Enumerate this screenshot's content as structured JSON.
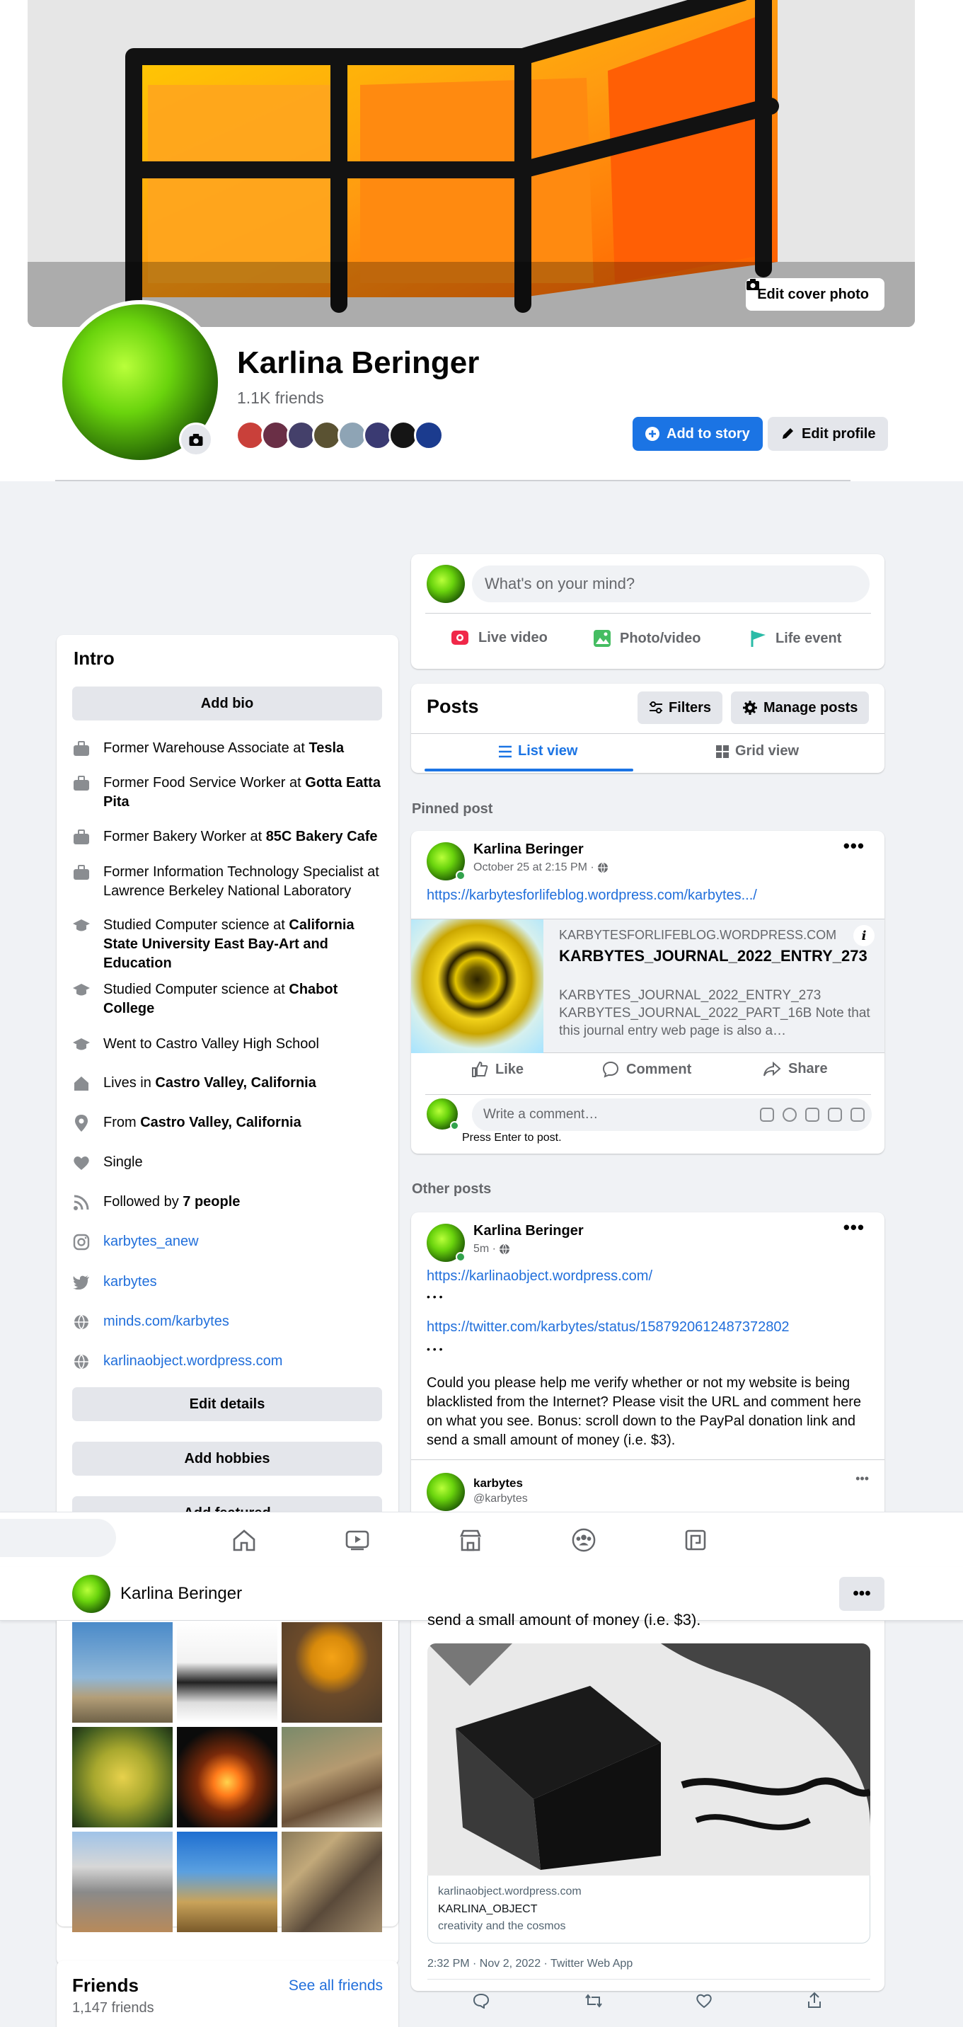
{
  "cover": {
    "edit_label": "Edit cover photo"
  },
  "profile": {
    "name": "Karlina Beringer",
    "friends_count": "1.1K friends",
    "add_story_label": "Add to story",
    "edit_profile_label": "Edit profile"
  },
  "intro": {
    "title": "Intro",
    "add_bio": "Add bio",
    "items": [
      {
        "icon": "briefcase-icon",
        "pre": "Former Warehouse Associate at ",
        "bold": "Tesla"
      },
      {
        "icon": "briefcase-icon",
        "pre": "Former Food Service Worker at ",
        "bold": "Gotta Eatta Pita"
      },
      {
        "icon": "briefcase-icon",
        "pre": "Former Bakery Worker at ",
        "bold": "85C Bakery Cafe"
      },
      {
        "icon": "briefcase-icon",
        "pre": "Former Information Technology Specialist at Lawrence Berkeley National Laboratory",
        "bold": ""
      },
      {
        "icon": "graduation-cap-icon",
        "pre": "Studied Computer science at ",
        "bold": "California State University East Bay-Art and Education"
      },
      {
        "icon": "graduation-cap-icon",
        "pre": "Studied Computer science at ",
        "bold": "Chabot College"
      },
      {
        "icon": "graduation-cap-icon",
        "pre": "Went to Castro Valley High School",
        "bold": ""
      },
      {
        "icon": "home-icon",
        "pre": "Lives in ",
        "bold": "Castro Valley, California"
      },
      {
        "icon": "location-pin-icon",
        "pre": "From ",
        "bold": "Castro Valley, California"
      },
      {
        "icon": "heart-icon",
        "pre": "Single",
        "bold": ""
      },
      {
        "icon": "rss-icon",
        "pre": "Followed by ",
        "bold": "7 people"
      }
    ],
    "links": [
      {
        "icon": "instagram-icon",
        "label": "karbytes_anew"
      },
      {
        "icon": "twitter-icon",
        "label": "karbytes"
      },
      {
        "icon": "globe-icon",
        "label": "minds.com/karbytes"
      },
      {
        "icon": "globe-icon",
        "label": "karlinaobject.wordpress.com"
      }
    ],
    "edit_details": "Edit details",
    "add_hobbies": "Add hobbies",
    "add_featured": "Add featured"
  },
  "composer": {
    "placeholder": "What's on your mind?",
    "live_video": "Live video",
    "photo_video": "Photo/video",
    "life_event": "Life event"
  },
  "posts_header": {
    "title": "Posts",
    "filters": "Filters",
    "manage_posts": "Manage posts",
    "list_view": "List view",
    "grid_view": "Grid view"
  },
  "pinned_label": "Pinned post",
  "other_label": "Other posts",
  "pinned_post": {
    "author": "Karlina Beringer",
    "meta": "October 25 at 2:15 PM · ",
    "link": "https://karbytesforlifeblog.wordpress.com/karbytes.../",
    "preview_domain": "KARBYTESFORLIFEBLOG.WORDPRESS.COM",
    "preview_title": "KARBYTES_JOURNAL_2022_ENTRY_273",
    "preview_desc": "KARBYTES_JOURNAL_2022_ENTRY_273 KARBYTES_JOURNAL_2022_PART_16B Note that this journal entry web page is also a…",
    "like": "Like",
    "comment": "Comment",
    "share": "Share",
    "comment_placeholder": "Write a comment…",
    "press_enter": "Press Enter to post."
  },
  "other_post": {
    "author": "Karlina Beringer",
    "meta": "5m · ",
    "link1": "https://karlinaobject.wordpress.com/",
    "ellipsis1": "• • •",
    "link2": "https://twitter.com/karbytes/status/1587920612487372802",
    "ellipsis2": "• • •",
    "body": "Could you please help me verify whether or not my website is being blacklisted from the Internet? Please visit the URL and comment here on what you see. Bonus: scroll down to the PayPal donation link and send a small amount of money (i.e. $3).",
    "embed_name": "karbytes",
    "embed_handle": "@karbytes",
    "embed_text_tail": "send a small amount of money (i.e. $3).",
    "embed_link_domain": "karlinaobject.wordpress.com",
    "embed_link_title": "KARLINA_OBJECT",
    "embed_link_desc": "creativity and the cosmos",
    "embed_time": "2:32 PM · Nov 2, 2022 · Twitter Web App"
  },
  "sticky": {
    "name": "Karlina Beringer",
    "more": "•••"
  },
  "friends": {
    "title": "Friends",
    "see_all": "See all friends",
    "count": "1,147 friends"
  },
  "colors": {
    "accent": "#1b74e4",
    "link": "#216fdb",
    "muted": "#65676b",
    "bg": "#f0f2f5"
  }
}
